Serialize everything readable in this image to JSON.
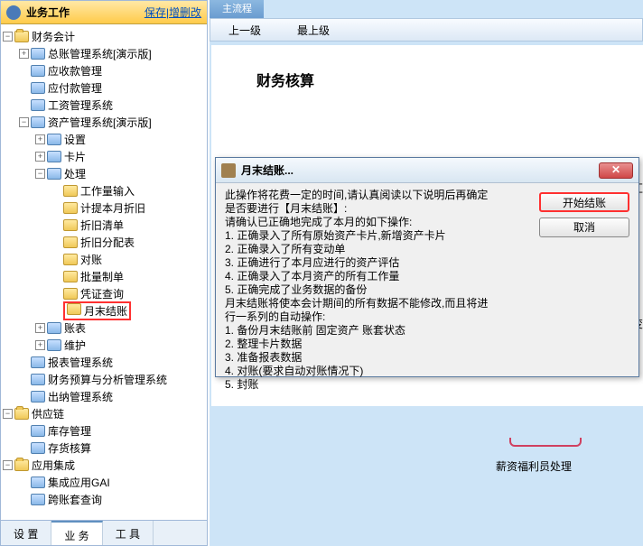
{
  "sidebar": {
    "title": "业务工作",
    "save_link": "保存",
    "modify_link": "增删改",
    "tree": {
      "root1": "财务会计",
      "n1": "总账管理系统[演示版]",
      "n2": "应收款管理",
      "n3": "应付款管理",
      "n4": "工资管理系统",
      "n5": "资产管理系统[演示版]",
      "n5_1": "设置",
      "n5_2": "卡片",
      "n5_3": "处理",
      "n5_3_1": "工作量输入",
      "n5_3_2": "计提本月折旧",
      "n5_3_3": "折旧清单",
      "n5_3_4": "折旧分配表",
      "n5_3_5": "对账",
      "n5_3_6": "批量制单",
      "n5_3_7": "凭证查询",
      "n5_3_8": "月末结账",
      "n5_4": "账表",
      "n5_5": "维护",
      "n6": "报表管理系统",
      "n7": "财务预算与分析管理系统",
      "n8": "出纳管理系统",
      "root2": "供应链",
      "r2_1": "库存管理",
      "r2_2": "存货核算",
      "root3": "应用集成",
      "r3_1": "集成应用GAI",
      "r3_2": "跨账套查询"
    },
    "tabs": {
      "t1": "设 置",
      "t2": "业 务",
      "t3": "工 具"
    }
  },
  "main": {
    "top_tab": "主流程",
    "nav1": "上一级",
    "nav2": "最上级",
    "page_title": "财务核算",
    "label": "薪资福利员处理",
    "right1": "汇",
    "right2": "变"
  },
  "dialog": {
    "title": "月末结账...",
    "body": "此操作将花费一定的时间,请认真阅读以下说明后再确定\n是否要进行【月末结账】:\n请确认已正确地完成了本月的如下操作:\n1. 正确录入了所有原始资产卡片,新增资产卡片\n2. 正确录入了所有变动单\n3. 正确进行了本月应进行的资产评估\n4. 正确录入了本月资产的所有工作量\n5. 正确完成了业务数据的备份\n月末结账将使本会计期间的所有数据不能修改,而且将进\n行一系列的自动操作:\n1. 备份月末结账前 固定资产 账套状态\n2. 整理卡片数据\n3. 准备报表数据\n4. 对账(要求自动对账情况下)\n5. 封账",
    "btn_start": "开始结账",
    "btn_cancel": "取消"
  }
}
